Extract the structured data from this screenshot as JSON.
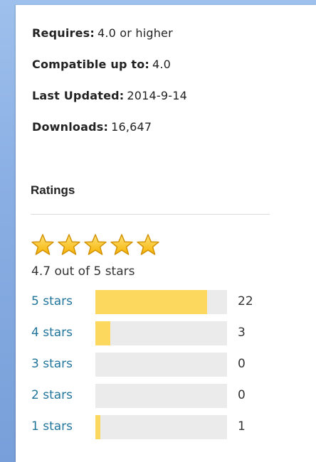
{
  "meta": {
    "requires": {
      "label": "Requires:",
      "value": "4.0 or higher"
    },
    "compatible": {
      "label": "Compatible up to:",
      "value": "4.0"
    },
    "updated": {
      "label": "Last Updated:",
      "value": "2014-9-14"
    },
    "downloads": {
      "label": "Downloads:",
      "value": "16,647"
    }
  },
  "ratings": {
    "heading": "Ratings",
    "summary": "4.7 out of 5 stars",
    "star_icon": "star-icon",
    "star_color": "#f5b301",
    "bar_color": "#fdd85e",
    "link_color": "#21759b",
    "bars": [
      {
        "label": "5 stars",
        "count": "22",
        "fraction": 0.8462
      },
      {
        "label": "4 stars",
        "count": "3",
        "fraction": 0.1154
      },
      {
        "label": "3 stars",
        "count": "0",
        "fraction": 0
      },
      {
        "label": "2 stars",
        "count": "0",
        "fraction": 0
      },
      {
        "label": "1 stars",
        "count": "1",
        "fraction": 0.0385
      }
    ]
  }
}
